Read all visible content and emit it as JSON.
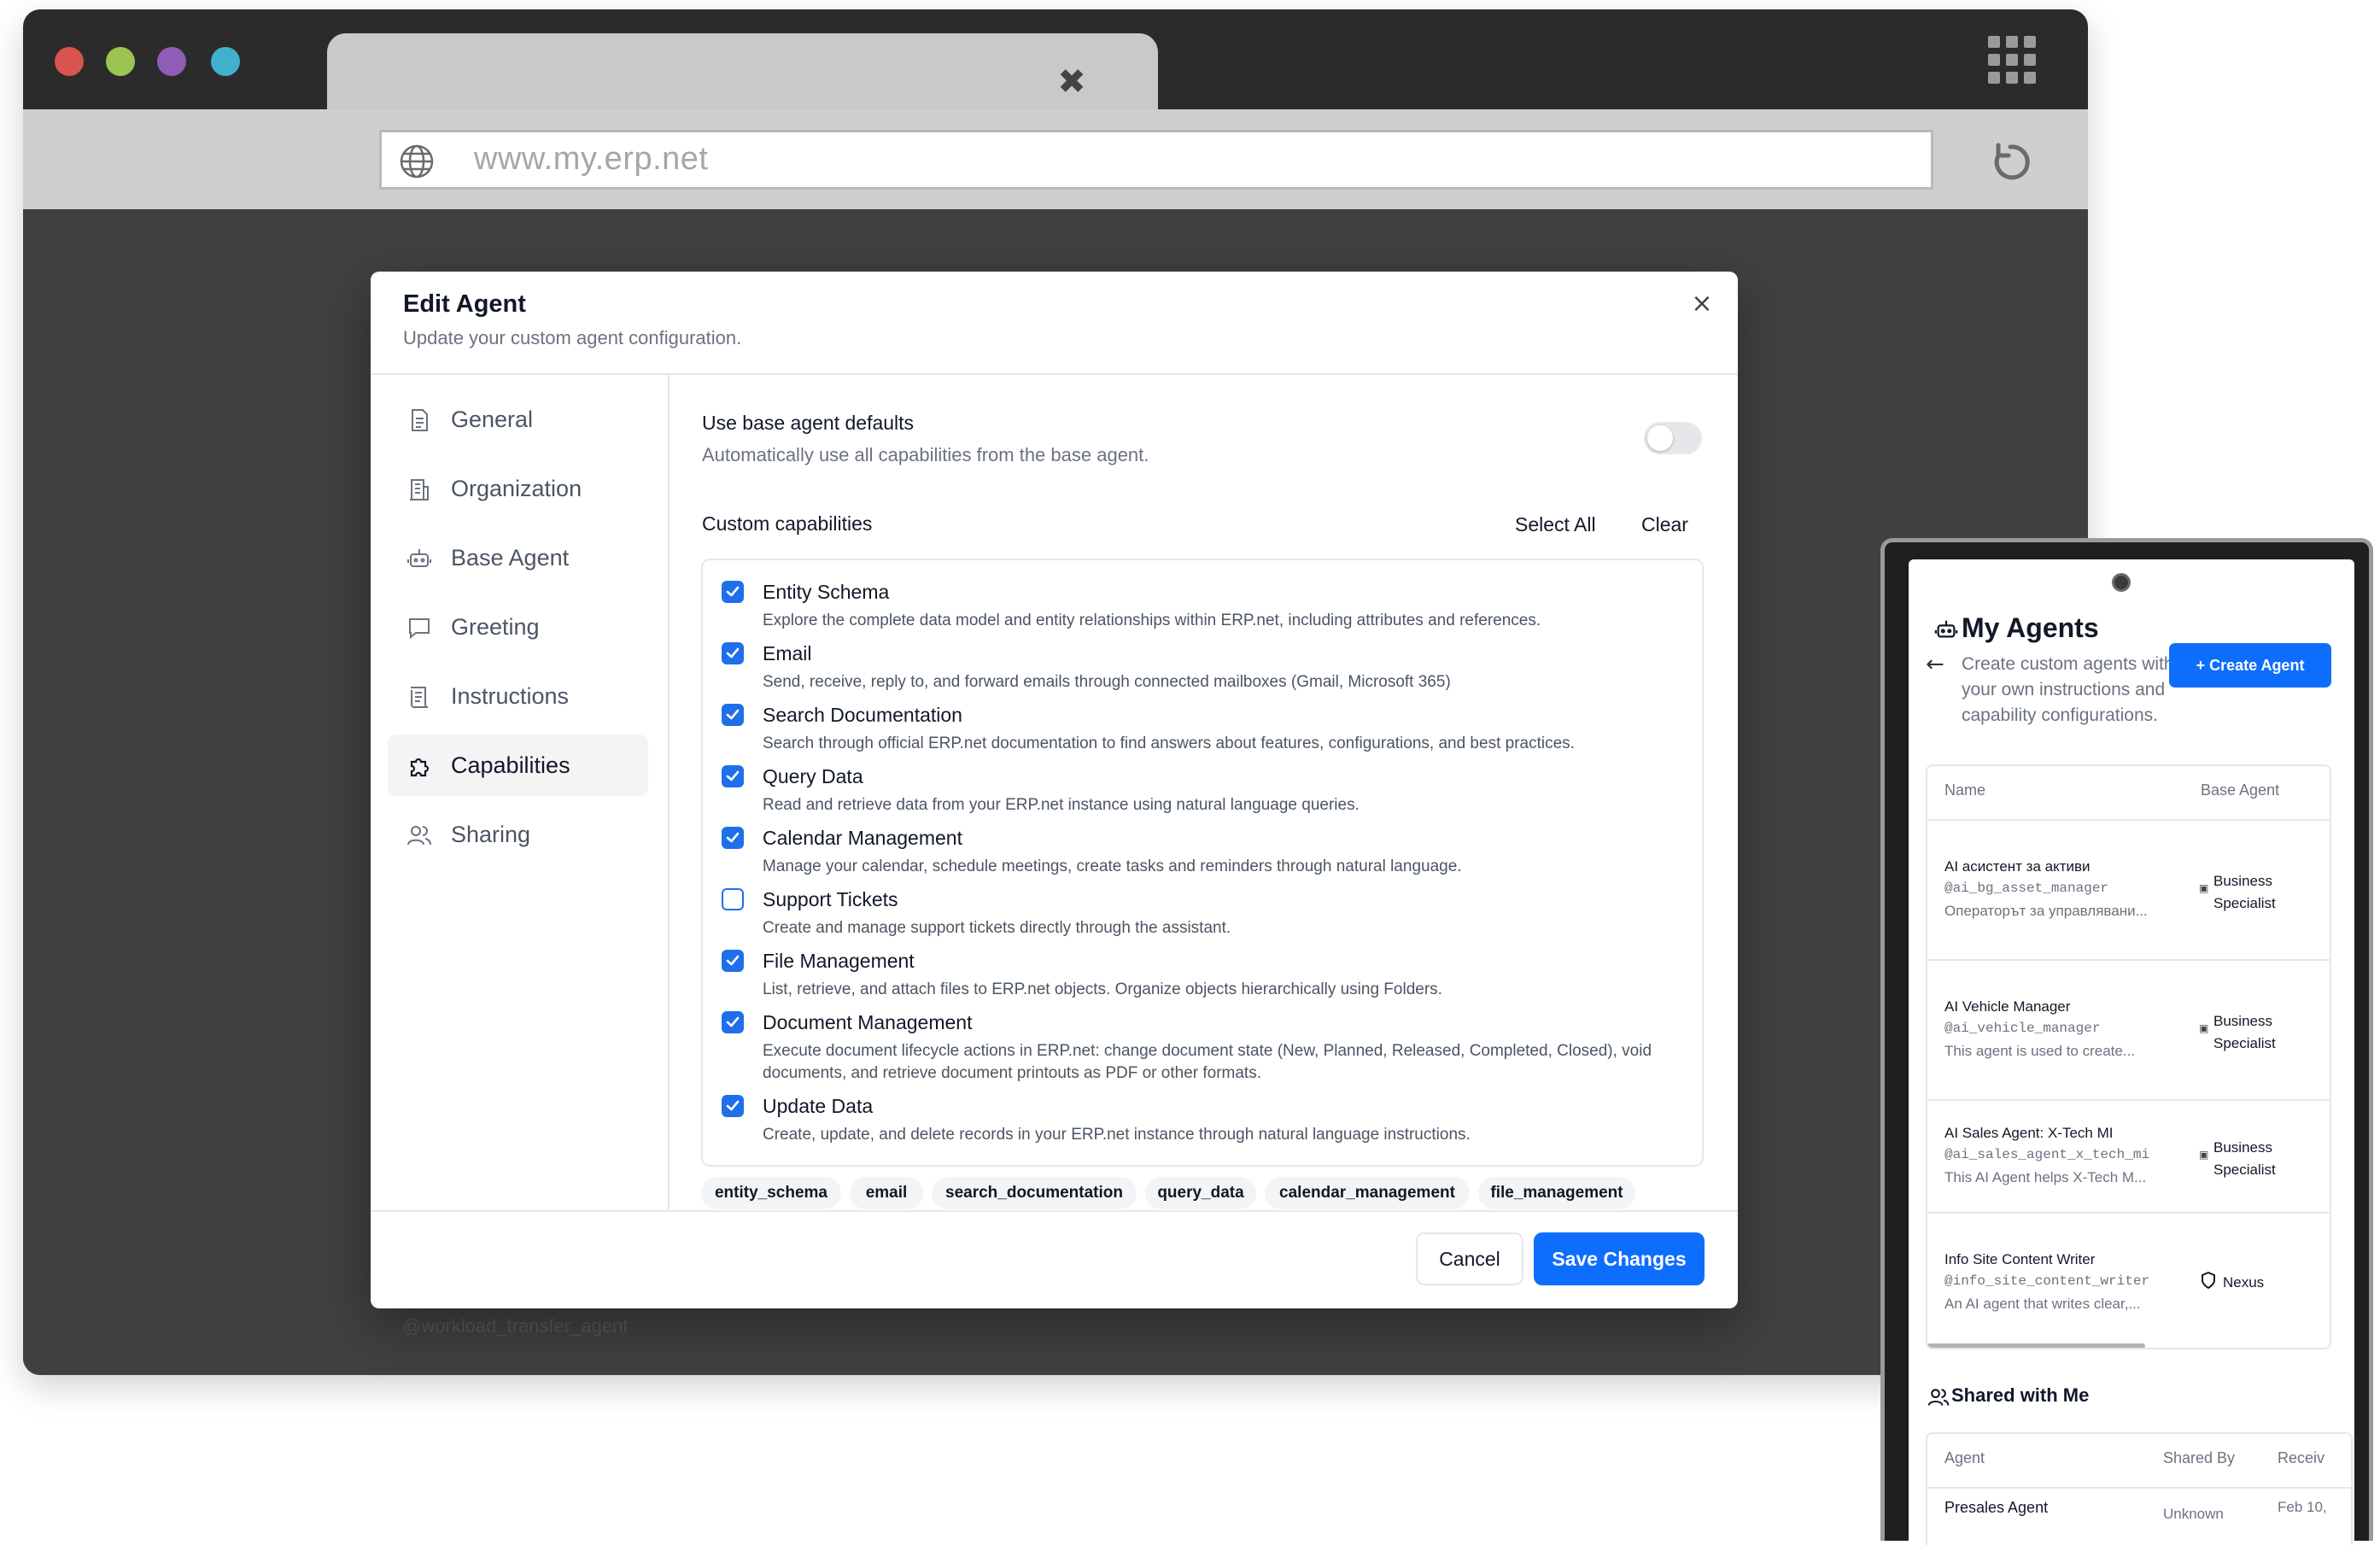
{
  "browser": {
    "url": "www.my.erp.net",
    "tab_close": "✖",
    "traffic_lights": [
      "#d9534f",
      "#9cc453",
      "#8e5db5",
      "#3fb1cc"
    ]
  },
  "modal": {
    "title": "Edit Agent",
    "subtitle": "Update your custom agent configuration.",
    "close": "×",
    "nav": [
      {
        "label": "General",
        "icon": "document-icon"
      },
      {
        "label": "Organization",
        "icon": "building-icon"
      },
      {
        "label": "Base Agent",
        "icon": "robot-icon"
      },
      {
        "label": "Greeting",
        "icon": "chat-bubble-icon"
      },
      {
        "label": "Instructions",
        "icon": "scroll-icon"
      },
      {
        "label": "Capabilities",
        "icon": "puzzle-icon",
        "active": true
      },
      {
        "label": "Sharing",
        "icon": "users-icon"
      }
    ],
    "base_defaults": {
      "title": "Use base agent defaults",
      "subtitle": "Automatically use all capabilities from the base agent.",
      "enabled": false
    },
    "custom": {
      "title": "Custom capabilities",
      "select_all": "Select All",
      "clear": "Clear"
    },
    "capabilities": [
      {
        "title": "Entity Schema",
        "desc": "Explore the complete data model and entity relationships within ERP.net, including attributes and references.",
        "checked": true
      },
      {
        "title": "Email",
        "desc": "Send, receive, reply to, and forward emails through connected mailboxes (Gmail, Microsoft 365)",
        "checked": true
      },
      {
        "title": "Search Documentation",
        "desc": "Search through official ERP.net documentation to find answers about features, configurations, and best practices.",
        "checked": true
      },
      {
        "title": "Query Data",
        "desc": "Read and retrieve data from your ERP.net instance using natural language queries.",
        "checked": true
      },
      {
        "title": "Calendar Management",
        "desc": "Manage your calendar, schedule meetings, create tasks and reminders through natural language.",
        "checked": true
      },
      {
        "title": "Support Tickets",
        "desc": "Create and manage support tickets directly through the assistant.",
        "checked": false
      },
      {
        "title": "File Management",
        "desc": "List, retrieve, and attach files to ERP.net objects. Organize objects hierarchically using Folders.",
        "checked": true
      },
      {
        "title": "Document Management",
        "desc": "Execute document lifecycle actions in ERP.net: change document state (New, Planned, Released, Completed, Closed), void documents, and retrieve document printouts as PDF or other formats.",
        "checked": true
      },
      {
        "title": "Update Data",
        "desc": "Create, update, and delete records in your ERP.net instance through natural language instructions.",
        "checked": true
      }
    ],
    "chips": [
      "entity_schema",
      "email",
      "search_documentation",
      "query_data",
      "calendar_management",
      "file_management"
    ],
    "cancel": "Cancel",
    "save": "Save Changes"
  },
  "background": {
    "row_handle": "@workload_transfer_agent"
  },
  "phone": {
    "title": "My Agents",
    "subtitle": "Create custom agents with your own instructions and capability configurations.",
    "back": "←",
    "create": "+  Create Agent",
    "columns": [
      "Name",
      "Base Agent"
    ],
    "rows": [
      {
        "name": "AI асистент за активи",
        "handle": "@ai_bg_asset_manager",
        "desc": "Операторът за управлявани...",
        "base": "Business Specialist"
      },
      {
        "name": "AI Vehicle Manager",
        "handle": "@ai_vehicle_manager",
        "desc": "This agent is used to create...",
        "base": "Business Specialist"
      },
      {
        "name": "AI Sales Agent: X-Tech MI",
        "handle": "@ai_sales_agent_x_tech_mi",
        "desc": "This AI Agent helps X-Tech M...",
        "base": "Business Specialist"
      },
      {
        "name": "Info Site Content Writer",
        "handle": "@info_site_content_writer",
        "desc": "An AI agent that writes clear,...",
        "base": "Nexus"
      }
    ],
    "shared_title": "Shared with Me",
    "shared_columns": [
      "Agent",
      "Shared By",
      "Receiv"
    ],
    "shared_rows": [
      {
        "agent": "Presales Agent",
        "by": "Unknown",
        "received": "Feb 10,"
      }
    ]
  }
}
